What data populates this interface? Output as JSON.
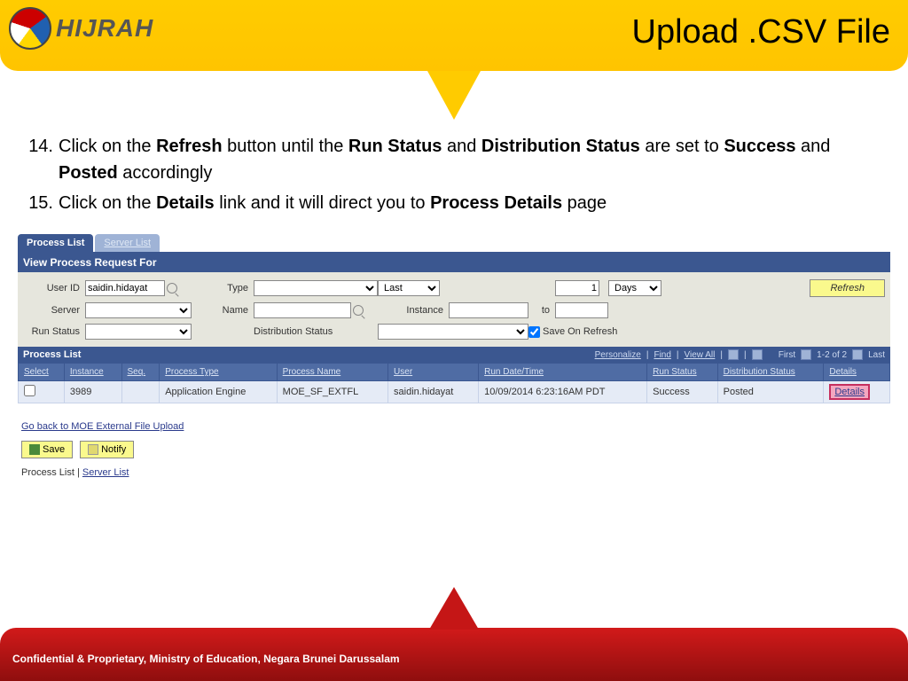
{
  "header": {
    "brand": "HIJRAH",
    "title": "Upload .CSV File"
  },
  "instructions": [
    {
      "n": "14.",
      "html": "Click on the <b>Refresh</b> button until the <b>Run Status</b> and <b>Distribution Status</b> are set to <b>Success</b> and <b>Posted</b> accordingly"
    },
    {
      "n": "15.",
      "html": "Click on the <b>Details</b> link and it will direct you to <b>Process Details</b> page"
    }
  ],
  "tabs": {
    "active": "Process List",
    "inactive": "Server List"
  },
  "section_title": "View Process Request For",
  "filter": {
    "labels": {
      "user_id": "User ID",
      "type": "Type",
      "last": "Last",
      "days": "Days",
      "server": "Server",
      "name": "Name",
      "instance": "Instance",
      "to": "to",
      "run_status": "Run Status",
      "dist_status": "Distribution Status",
      "save_refresh": "Save On Refresh"
    },
    "user_id": "saidin.hidayat",
    "last_value": "1",
    "refresh": "Refresh"
  },
  "grid": {
    "title": "Process List",
    "toolbar": {
      "personalize": "Personalize",
      "find": "Find",
      "view_all": "View All",
      "first": "First",
      "count": "1-2 of 2",
      "last": "Last"
    },
    "cols": [
      "Select",
      "Instance",
      "Seq.",
      "Process Type",
      "Process Name",
      "User",
      "Run Date/Time",
      "Run Status",
      "Distribution Status",
      "Details"
    ],
    "row": {
      "instance": "3989",
      "seq": "",
      "ptype": "Application Engine",
      "pname": "MOE_SF_EXTFL",
      "user": "saidin.hidayat",
      "dt": "10/09/2014  6:23:16AM PDT",
      "rstatus": "Success",
      "dstatus": "Posted",
      "details": "Details"
    }
  },
  "back_link": "Go back to MOE External File Upload",
  "buttons": {
    "save": "Save",
    "notify": "Notify"
  },
  "breadcrumb": {
    "a": "Process List",
    "b": "Server List"
  },
  "footer": "Confidential & Proprietary, Ministry of Education, Negara Brunei Darussalam"
}
